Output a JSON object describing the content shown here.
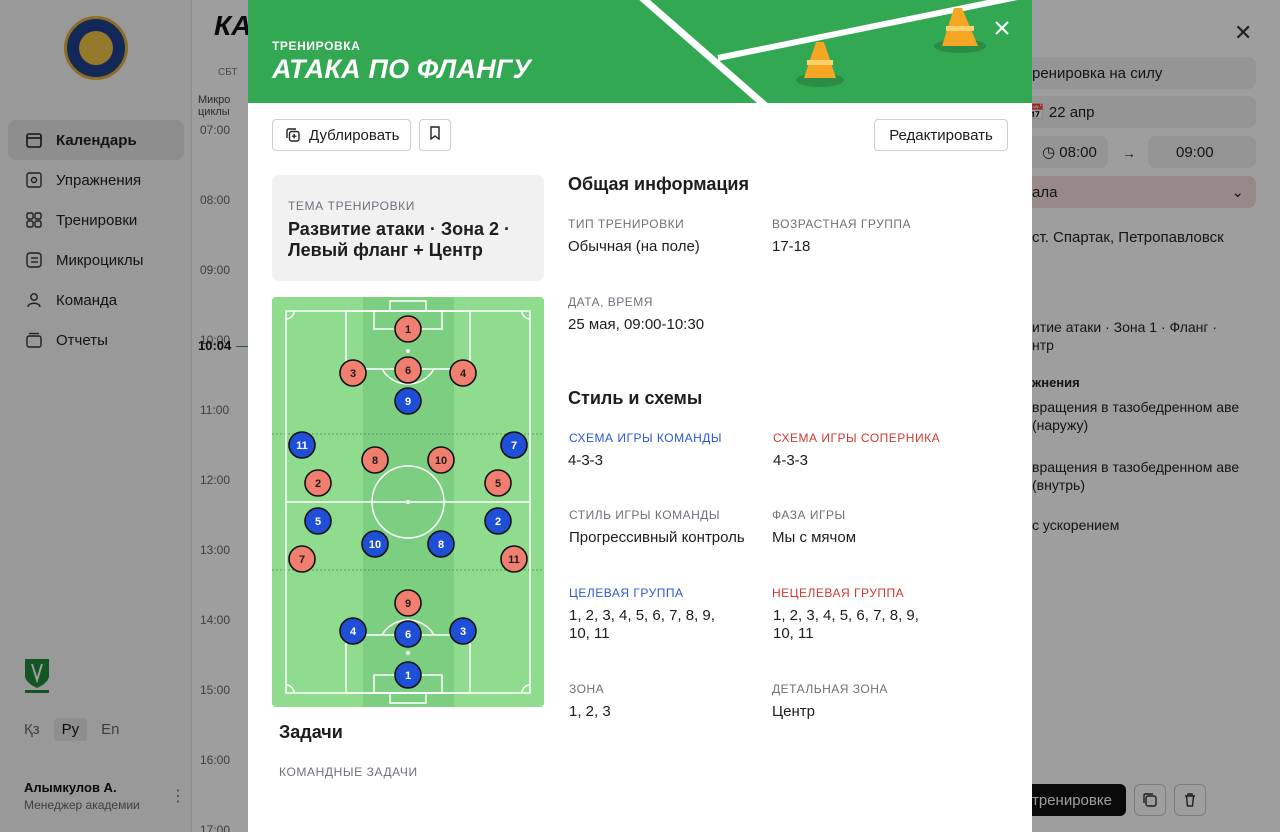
{
  "background": {
    "nav": [
      {
        "label": "Календарь",
        "icon": "calendar-icon",
        "active": true
      },
      {
        "label": "Упражнения",
        "icon": "exercise-icon",
        "active": false
      },
      {
        "label": "Тренировки",
        "icon": "grid-icon",
        "active": false
      },
      {
        "label": "Микроциклы",
        "icon": "list-icon",
        "active": false
      },
      {
        "label": "Команда",
        "icon": "person-icon",
        "active": false
      },
      {
        "label": "Отчеты",
        "icon": "stack-icon",
        "active": false
      }
    ],
    "languages": [
      "Қз",
      "Ру",
      "En"
    ],
    "active_language": "Ру",
    "user_name": "Алымкулов А.",
    "user_role": "Менеджер академии",
    "calendar_title": "КА",
    "weekday": "СБТ",
    "micro_label": "Микро\nциклы",
    "times": [
      "07:00",
      "08:00",
      "09:00",
      "10:00",
      "11:00",
      "12:00",
      "13:00",
      "14:00",
      "15:00",
      "16:00",
      "17:00"
    ],
    "now_time": "10:04",
    "right_panel": {
      "title_field": "ренировка на силу",
      "date": "22 апр",
      "time_from": "08:00",
      "time_to": "09:00",
      "select_text": "ала",
      "location": "ст. Спартак, Петропавловск",
      "theme_partial": "итие атаки · Зона 1 · Фланг · нтр",
      "exercises_header": "жнения",
      "exercise_1": "вращения в тазобедренном аве (наружу)",
      "exercise_2": "вращения в тазобедренном аве (внутрь)",
      "exercise_3": "с ускорением",
      "button": "тренировке"
    }
  },
  "modal": {
    "subtitle": "ТРЕНИРОВКА",
    "title": "АТАКА ПО ФЛАНГУ",
    "buttons": {
      "duplicate": "Дублировать",
      "edit": "Редактировать"
    },
    "theme": {
      "label": "ТЕМА ТРЕНИРОВКИ",
      "text": "Развитие атаки · Зона 2 · Левый фланг + Центр"
    },
    "tasks": {
      "title": "Задачи",
      "subtitle": "КОМАНДНЫЕ ЗАДАЧИ"
    },
    "general": {
      "title": "Общая информация",
      "type_label": "ТИП ТРЕНИРОВКИ",
      "type_value": "Обычная (на поле)",
      "age_label": "ВОЗРАСТНАЯ ГРУППА",
      "age_value": "17-18",
      "datetime_label": "ДАТА, ВРЕМЯ",
      "datetime_value": "25 мая, 09:00-10:30"
    },
    "style": {
      "title": "Стиль и схемы",
      "team_scheme_label": "СХЕМА ИГРЫ КОМАНДЫ",
      "team_scheme_value": "4-3-3",
      "opp_scheme_label": "СХЕМА ИГРЫ СОПЕРНИКА",
      "opp_scheme_value": "4-3-3",
      "team_style_label": "СТИЛЬ ИГРЫ КОМАНДЫ",
      "team_style_value": "Прогрессивный контроль",
      "phase_label": "ФАЗА ИГРЫ",
      "phase_value": "Мы с мячом",
      "target_label": "ЦЕЛЕВАЯ ГРУППА",
      "target_value": "1, 2, 3, 4, 5, 6, 7, 8, 9, 10, 11",
      "nontarget_label": "НЕЦЕЛЕВАЯ ГРУППА",
      "nontarget_value": "1, 2, 3, 4, 5, 6, 7, 8, 9, 10, 11",
      "zone_label": "ЗОНА",
      "zone_value": "1, 2, 3",
      "detail_zone_label": "ДЕТАЛЬНАЯ ЗОНА",
      "detail_zone_value": "Центр"
    },
    "colors": {
      "banner": "#32a853",
      "team": "#1f4fd6",
      "opponent": "#f17f6f"
    },
    "opponent_players": [
      "1",
      "3",
      "6",
      "4",
      "8",
      "10",
      "2",
      "5",
      "7",
      "11",
      "9"
    ],
    "team_players": [
      "9",
      "11",
      "7",
      "5",
      "2",
      "10",
      "8",
      "4",
      "6",
      "3",
      "1"
    ]
  }
}
